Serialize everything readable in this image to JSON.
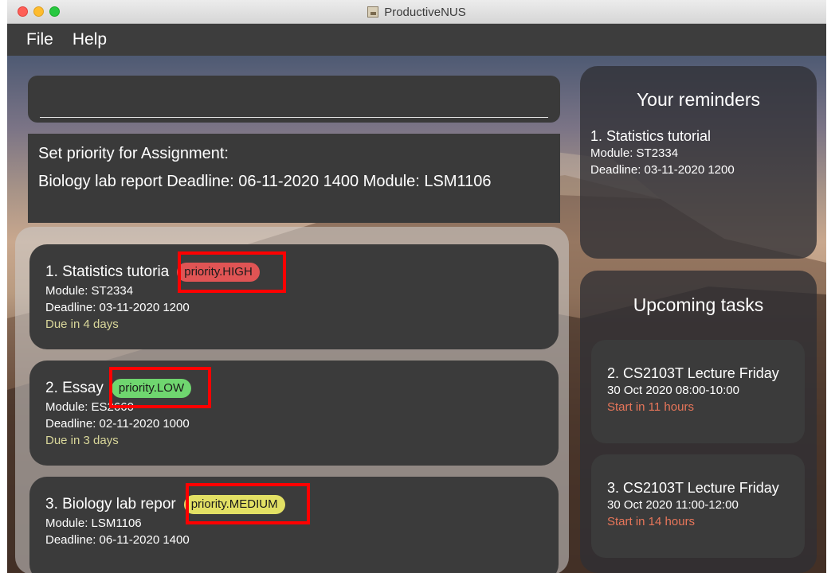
{
  "window": {
    "title": "ProductiveNUS"
  },
  "menu": [
    {
      "label": "File"
    },
    {
      "label": "Help"
    }
  ],
  "command": {
    "value": ""
  },
  "result": {
    "line1": "Set priority for Assignment:",
    "line2": "Biology lab report Deadline: 06-11-2020 1400 Module: LSM1106"
  },
  "tasks": [
    {
      "title": "1.  Statistics tutoria",
      "priority": "priority.HIGH",
      "priority_color": "#e05454",
      "module": "Module: ST2334",
      "deadline": "Deadline: 03-11-2020 1200",
      "due": "Due in 4 days"
    },
    {
      "title": "2.  Essay",
      "priority": "priority.LOW",
      "priority_color": "#6fd66f",
      "module": "Module: ES2660",
      "deadline": "Deadline: 02-11-2020 1000",
      "due": "Due in 3 days"
    },
    {
      "title": "3.  Biology lab repor",
      "priority": "priority.MEDIUM",
      "priority_color": "#e2e064",
      "module": "Module: LSM1106",
      "deadline": "Deadline: 06-11-2020 1400",
      "due": ""
    }
  ],
  "reminders": {
    "heading": "Your reminders",
    "items": [
      {
        "title": "1.  Statistics tutorial",
        "module": "Module: ST2334",
        "deadline": "Deadline: 03-11-2020 1200"
      }
    ]
  },
  "upcoming": {
    "heading": "Upcoming tasks",
    "items": [
      {
        "title": "2.  CS2103T Lecture Friday",
        "time": "30 Oct 2020 08:00-10:00",
        "start": "Start in 11 hours"
      },
      {
        "title": "3.  CS2103T Lecture Friday",
        "time": "30 Oct 2020 11:00-12:00",
        "start": "Start in 14 hours"
      }
    ]
  },
  "colors": {
    "highlight": "#ff0000",
    "due": "#d9d79a",
    "start": "#e8765a"
  }
}
